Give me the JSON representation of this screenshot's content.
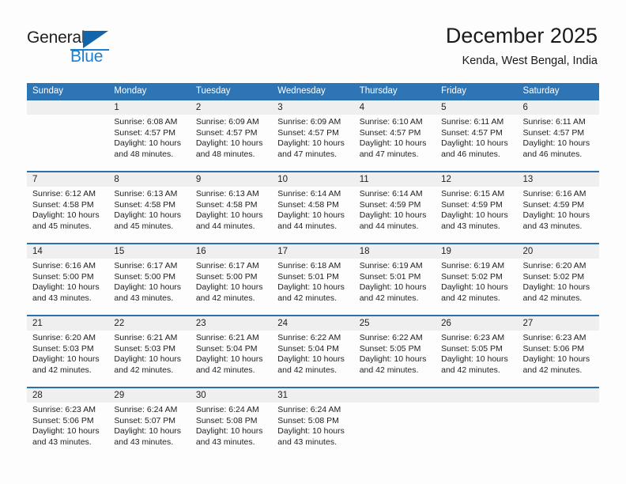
{
  "logo": {
    "word1": "General",
    "word2": "Blue",
    "triangle_color": "#1464AA",
    "blue_color": "#1B7FD4"
  },
  "header": {
    "title": "December 2025",
    "location": "Kenda, West Bengal, India"
  },
  "theme": {
    "header_bar": "#2E75B6",
    "row_rule": "#2E6FAE",
    "daynum_band": "#EFEFEF",
    "page_bg": "#FDFDFD"
  },
  "calendar": {
    "weekdays": [
      "Sunday",
      "Monday",
      "Tuesday",
      "Wednesday",
      "Thursday",
      "Friday",
      "Saturday"
    ],
    "weeks": [
      [
        {
          "day": "",
          "lines": []
        },
        {
          "day": "1",
          "lines": [
            "Sunrise: 6:08 AM",
            "Sunset: 4:57 PM",
            "Daylight: 10 hours",
            "and 48 minutes."
          ]
        },
        {
          "day": "2",
          "lines": [
            "Sunrise: 6:09 AM",
            "Sunset: 4:57 PM",
            "Daylight: 10 hours",
            "and 48 minutes."
          ]
        },
        {
          "day": "3",
          "lines": [
            "Sunrise: 6:09 AM",
            "Sunset: 4:57 PM",
            "Daylight: 10 hours",
            "and 47 minutes."
          ]
        },
        {
          "day": "4",
          "lines": [
            "Sunrise: 6:10 AM",
            "Sunset: 4:57 PM",
            "Daylight: 10 hours",
            "and 47 minutes."
          ]
        },
        {
          "day": "5",
          "lines": [
            "Sunrise: 6:11 AM",
            "Sunset: 4:57 PM",
            "Daylight: 10 hours",
            "and 46 minutes."
          ]
        },
        {
          "day": "6",
          "lines": [
            "Sunrise: 6:11 AM",
            "Sunset: 4:57 PM",
            "Daylight: 10 hours",
            "and 46 minutes."
          ]
        }
      ],
      [
        {
          "day": "7",
          "lines": [
            "Sunrise: 6:12 AM",
            "Sunset: 4:58 PM",
            "Daylight: 10 hours",
            "and 45 minutes."
          ]
        },
        {
          "day": "8",
          "lines": [
            "Sunrise: 6:13 AM",
            "Sunset: 4:58 PM",
            "Daylight: 10 hours",
            "and 45 minutes."
          ]
        },
        {
          "day": "9",
          "lines": [
            "Sunrise: 6:13 AM",
            "Sunset: 4:58 PM",
            "Daylight: 10 hours",
            "and 44 minutes."
          ]
        },
        {
          "day": "10",
          "lines": [
            "Sunrise: 6:14 AM",
            "Sunset: 4:58 PM",
            "Daylight: 10 hours",
            "and 44 minutes."
          ]
        },
        {
          "day": "11",
          "lines": [
            "Sunrise: 6:14 AM",
            "Sunset: 4:59 PM",
            "Daylight: 10 hours",
            "and 44 minutes."
          ]
        },
        {
          "day": "12",
          "lines": [
            "Sunrise: 6:15 AM",
            "Sunset: 4:59 PM",
            "Daylight: 10 hours",
            "and 43 minutes."
          ]
        },
        {
          "day": "13",
          "lines": [
            "Sunrise: 6:16 AM",
            "Sunset: 4:59 PM",
            "Daylight: 10 hours",
            "and 43 minutes."
          ]
        }
      ],
      [
        {
          "day": "14",
          "lines": [
            "Sunrise: 6:16 AM",
            "Sunset: 5:00 PM",
            "Daylight: 10 hours",
            "and 43 minutes."
          ]
        },
        {
          "day": "15",
          "lines": [
            "Sunrise: 6:17 AM",
            "Sunset: 5:00 PM",
            "Daylight: 10 hours",
            "and 43 minutes."
          ]
        },
        {
          "day": "16",
          "lines": [
            "Sunrise: 6:17 AM",
            "Sunset: 5:00 PM",
            "Daylight: 10 hours",
            "and 42 minutes."
          ]
        },
        {
          "day": "17",
          "lines": [
            "Sunrise: 6:18 AM",
            "Sunset: 5:01 PM",
            "Daylight: 10 hours",
            "and 42 minutes."
          ]
        },
        {
          "day": "18",
          "lines": [
            "Sunrise: 6:19 AM",
            "Sunset: 5:01 PM",
            "Daylight: 10 hours",
            "and 42 minutes."
          ]
        },
        {
          "day": "19",
          "lines": [
            "Sunrise: 6:19 AM",
            "Sunset: 5:02 PM",
            "Daylight: 10 hours",
            "and 42 minutes."
          ]
        },
        {
          "day": "20",
          "lines": [
            "Sunrise: 6:20 AM",
            "Sunset: 5:02 PM",
            "Daylight: 10 hours",
            "and 42 minutes."
          ]
        }
      ],
      [
        {
          "day": "21",
          "lines": [
            "Sunrise: 6:20 AM",
            "Sunset: 5:03 PM",
            "Daylight: 10 hours",
            "and 42 minutes."
          ]
        },
        {
          "day": "22",
          "lines": [
            "Sunrise: 6:21 AM",
            "Sunset: 5:03 PM",
            "Daylight: 10 hours",
            "and 42 minutes."
          ]
        },
        {
          "day": "23",
          "lines": [
            "Sunrise: 6:21 AM",
            "Sunset: 5:04 PM",
            "Daylight: 10 hours",
            "and 42 minutes."
          ]
        },
        {
          "day": "24",
          "lines": [
            "Sunrise: 6:22 AM",
            "Sunset: 5:04 PM",
            "Daylight: 10 hours",
            "and 42 minutes."
          ]
        },
        {
          "day": "25",
          "lines": [
            "Sunrise: 6:22 AM",
            "Sunset: 5:05 PM",
            "Daylight: 10 hours",
            "and 42 minutes."
          ]
        },
        {
          "day": "26",
          "lines": [
            "Sunrise: 6:23 AM",
            "Sunset: 5:05 PM",
            "Daylight: 10 hours",
            "and 42 minutes."
          ]
        },
        {
          "day": "27",
          "lines": [
            "Sunrise: 6:23 AM",
            "Sunset: 5:06 PM",
            "Daylight: 10 hours",
            "and 42 minutes."
          ]
        }
      ],
      [
        {
          "day": "28",
          "lines": [
            "Sunrise: 6:23 AM",
            "Sunset: 5:06 PM",
            "Daylight: 10 hours",
            "and 43 minutes."
          ]
        },
        {
          "day": "29",
          "lines": [
            "Sunrise: 6:24 AM",
            "Sunset: 5:07 PM",
            "Daylight: 10 hours",
            "and 43 minutes."
          ]
        },
        {
          "day": "30",
          "lines": [
            "Sunrise: 6:24 AM",
            "Sunset: 5:08 PM",
            "Daylight: 10 hours",
            "and 43 minutes."
          ]
        },
        {
          "day": "31",
          "lines": [
            "Sunrise: 6:24 AM",
            "Sunset: 5:08 PM",
            "Daylight: 10 hours",
            "and 43 minutes."
          ]
        },
        {
          "day": "",
          "lines": []
        },
        {
          "day": "",
          "lines": []
        },
        {
          "day": "",
          "lines": []
        }
      ]
    ]
  }
}
